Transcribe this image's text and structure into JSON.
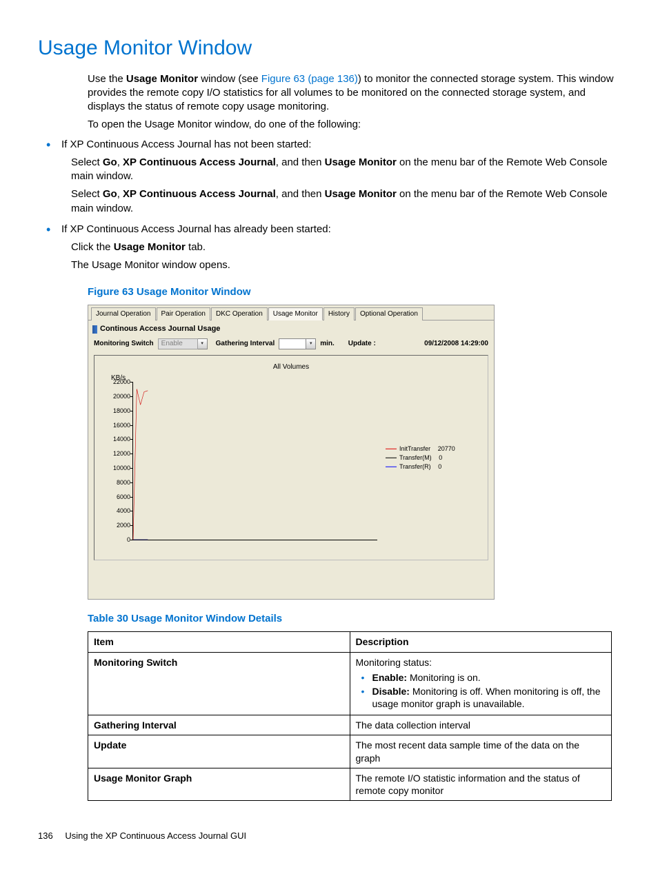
{
  "title": "Usage Monitor Window",
  "intro": {
    "use_the": "Use the ",
    "um": "Usage Monitor",
    "window_see": " window (see ",
    "fig_link": "Figure 63 (page 136)",
    "after_link": ") to monitor the connected storage system. This window provides the remote copy I/O statistics for all volumes to be monitored on the connected storage system, and displays the status of remote copy usage monitoring.",
    "open_line": "To open the Usage Monitor window, do one of the following:"
  },
  "bullets": {
    "not_started": "If XP Continuous Access Journal has not been started:",
    "sel_prefix": "Select ",
    "go": "Go",
    "comma": ", ",
    "xpcaj": "XP Continuous Access Journal",
    "and_then": ", and then ",
    "um2": "Usage Monitor",
    "menu_tail": " on the menu bar of the Remote Web Console main window.",
    "already": "If XP Continuous Access Journal has already been started:",
    "click_the": "Click the ",
    "tab": " tab.",
    "opens": "The Usage Monitor window opens."
  },
  "figure_caption": "Figure 63 Usage Monitor Window",
  "shot": {
    "tabs": [
      "Journal Operation",
      "Pair Operation",
      "DKC Operation",
      "Usage Monitor",
      "History",
      "Optional Operation"
    ],
    "active_tab_index": 3,
    "inner_title": "Continous Access Journal Usage",
    "mon_switch_label": "Monitoring Switch",
    "mon_switch_value": "Enable",
    "gather_label": "Gathering Interval",
    "gather_unit": "min.",
    "update_label": "Update :",
    "update_value": "09/12/2008 14:29:00",
    "chart_title": "All Volumes",
    "y_unit": "KB/s",
    "legend": [
      {
        "name": "InitTransfer",
        "value": "20770"
      },
      {
        "name": "Transfer(M)",
        "value": "0"
      },
      {
        "name": "Transfer(R)",
        "value": "0"
      }
    ]
  },
  "chart_data": {
    "type": "line",
    "title": "All Volumes",
    "ylabel": "KB/s",
    "ylim": [
      0,
      22000
    ],
    "y_ticks": [
      0,
      2000,
      4000,
      6000,
      8000,
      10000,
      12000,
      14000,
      16000,
      18000,
      20000,
      22000
    ],
    "series": [
      {
        "name": "InitTransfer",
        "color": "#d00000",
        "values": [
          0,
          21000,
          18800,
          20600,
          20770
        ]
      },
      {
        "name": "Transfer(M)",
        "color": "#000000",
        "values": [
          0,
          0,
          0,
          0,
          0
        ]
      },
      {
        "name": "Transfer(R)",
        "color": "#0000ff",
        "values": [
          0,
          0,
          0,
          0,
          0
        ]
      }
    ]
  },
  "table_caption": "Table 30 Usage Monitor Window Details",
  "table": {
    "head_item": "Item",
    "head_desc": "Description",
    "rows": [
      {
        "item": "Monitoring Switch",
        "desc_lead": "Monitoring status:",
        "li1_b": "Enable:",
        "li1_t": " Monitoring is on.",
        "li2_b": "Disable:",
        "li2_t": " Monitoring is off. When monitoring is off, the usage monitor graph is unavailable."
      },
      {
        "item": "Gathering Interval",
        "desc": "The data collection interval"
      },
      {
        "item": "Update",
        "desc": "The most recent data sample time of the data on the graph"
      },
      {
        "item": "Usage Monitor Graph",
        "desc": "The remote I/O statistic information and the status of remote copy monitor"
      }
    ]
  },
  "footer": {
    "page": "136",
    "chapter": "Using the XP Continuous Access Journal GUI"
  }
}
